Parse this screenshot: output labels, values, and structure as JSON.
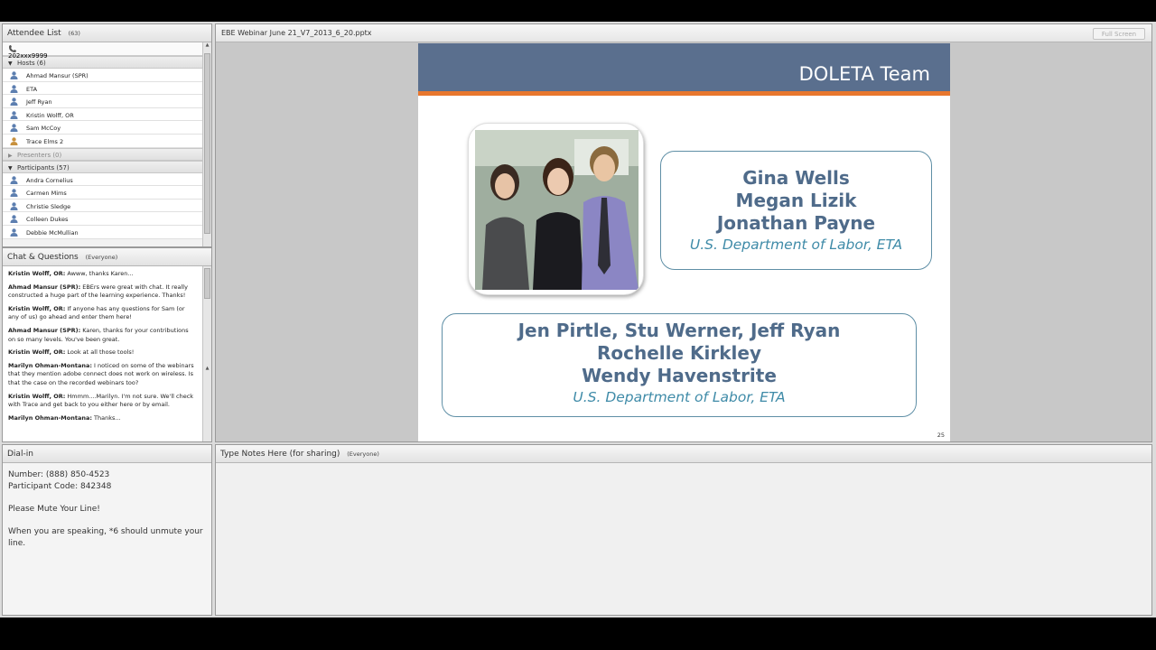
{
  "attendee": {
    "title": "Attendee List",
    "count": "(63)",
    "dial_number": "202xxx9999",
    "hosts_label": "Hosts (6)",
    "hosts": [
      "Ahmad Mansur (SPR)",
      "ETA",
      "Jeff Ryan",
      "Kristin Wolff, OR",
      "Sam McCoy",
      "Trace Elms 2"
    ],
    "presenters_label": "Presenters (0)",
    "participants_label": "Participants (57)",
    "participants": [
      "Andra Cornelius",
      "Carmen Mims",
      "Christie Sledge",
      "Colleen Dukes",
      "Debbie McMullian"
    ]
  },
  "chat": {
    "title": "Chat & Questions",
    "scope": "(Everyone)",
    "messages": [
      {
        "sender": "Kristin Wolff, OR:",
        "text": "Awww, thanks Karen..."
      },
      {
        "sender": "Ahmad Mansur (SPR):",
        "text": "EBErs were great with chat. It really constructed a huge part of the learning experience. Thanks!"
      },
      {
        "sender": "Kristin Wolff, OR:",
        "text": "If anyone has any questions for Sam (or any of us) go ahead and enter them here!"
      },
      {
        "sender": "Ahmad Mansur (SPR):",
        "text": "Karen, thanks for your contributions on so many levels. You've been great."
      },
      {
        "sender": "Kristin Wolff, OR:",
        "text": "Look at all those tools!"
      },
      {
        "sender": "Marilyn Ohman-Montana:",
        "text": "I noticed on some of the webinars that they mention adobe connect does not work on wireless. Is that the case on the recorded webinars too?"
      },
      {
        "sender": "Kristin Wolff, OR:",
        "text": "Hmmm....Marilyn. I'm not sure. We'll check with Trace and get back to you either here or by email."
      },
      {
        "sender": "Marilyn Ohman-Montana:",
        "text": "Thanks..."
      }
    ]
  },
  "share": {
    "filename": "EBE Webinar June 21_V7_2013_6_20.pptx",
    "fullscreen_label": "Full Screen",
    "slide": {
      "title": "DOLETA Team",
      "box1_names": [
        "Gina Wells",
        "Megan Lizik",
        "Jonathan Payne"
      ],
      "box1_org": "U.S. Department of Labor, ETA",
      "box2_names": [
        "Jen Pirtle, Stu Werner, Jeff Ryan",
        "Rochelle Kirkley",
        "Wendy Havenstrite"
      ],
      "box2_org": "U.S. Department of Labor, ETA",
      "page_number": "25"
    }
  },
  "dialin": {
    "title": "Dial-in",
    "number_line": "Number: (888) 850-4523",
    "code_line": "Participant Code: 842348",
    "mute_line": "Please Mute Your Line!",
    "unmute_line": "When you are speaking, *6 should unmute your line."
  },
  "notes": {
    "title": "Type Notes Here (for sharing)",
    "scope": "(Everyone)"
  },
  "colors": {
    "slide_header": "#5a6f8e",
    "slide_accent": "#e8772e",
    "name_text": "#4f6b8a",
    "org_text": "#3f8ba8"
  }
}
